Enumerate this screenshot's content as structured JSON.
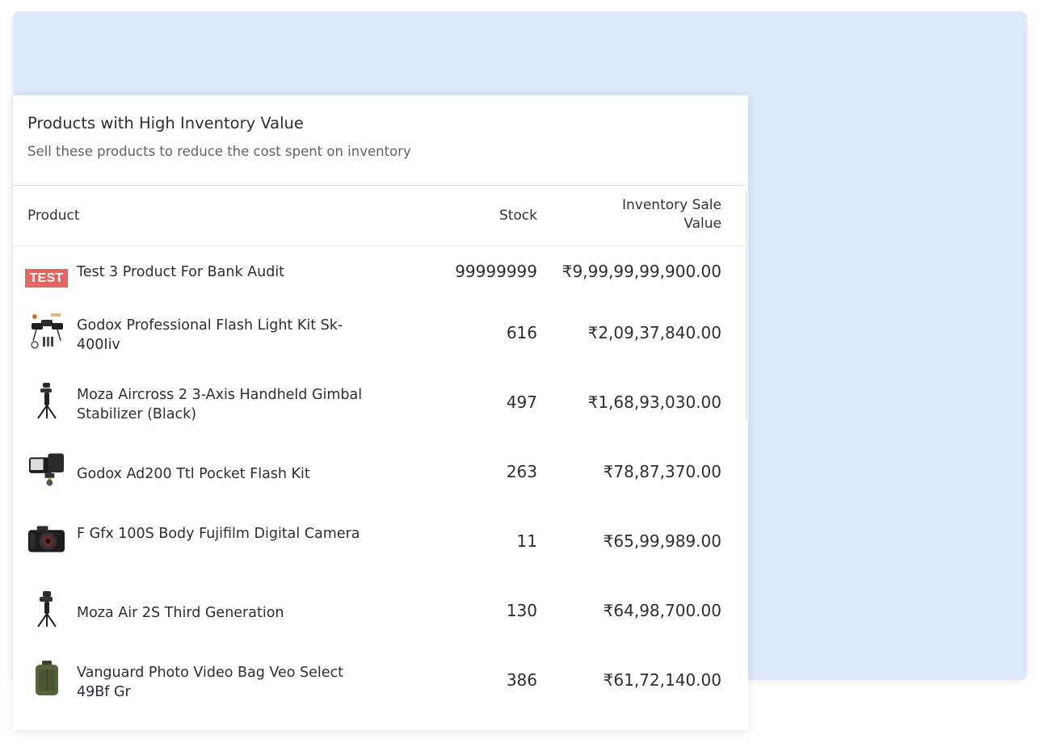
{
  "card": {
    "title": "Products with High Inventory Value",
    "subtitle": "Sell these products to reduce the cost spent on inventory"
  },
  "table": {
    "headers": {
      "product": "Product",
      "stock": "Stock",
      "value_line1": "Inventory Sale",
      "value_line2": "Value"
    },
    "rows": [
      {
        "thumb": "test-badge",
        "badge_text": "TEST",
        "name": "Test 3 Product For Bank Audit",
        "stock": "99999999",
        "value": "₹9,99,99,99,900.00"
      },
      {
        "thumb": "flash-light-kit-icon",
        "name": "Godox Professional Flash Light Kit Sk-400Iiv",
        "stock": "616",
        "value": "₹2,09,37,840.00"
      },
      {
        "thumb": "gimbal-icon",
        "name": "Moza Aircross 2 3-Axis Handheld Gimbal Stabilizer (Black)",
        "stock": "497",
        "value": "₹1,68,93,030.00"
      },
      {
        "thumb": "pocket-flash-icon",
        "name": "Godox Ad200 Ttl Pocket Flash Kit",
        "stock": "263",
        "value": "₹78,87,370.00"
      },
      {
        "thumb": "camera-icon",
        "name": "F Gfx 100S Body Fujifilm Digital Camera",
        "stock": "11",
        "value": "₹65,99,989.00"
      },
      {
        "thumb": "gimbal-icon",
        "name": "Moza Air 2S Third Generation",
        "stock": "130",
        "value": "₹64,98,700.00"
      },
      {
        "thumb": "camera-bag-icon",
        "name": "Vanguard Photo Video Bag Veo Select 49Bf Gr",
        "stock": "386",
        "value": "₹61,72,140.00"
      }
    ]
  },
  "colors": {
    "background_panel": "#dbe9fb",
    "test_badge": "#e4655f",
    "text": "#2b2f33"
  }
}
